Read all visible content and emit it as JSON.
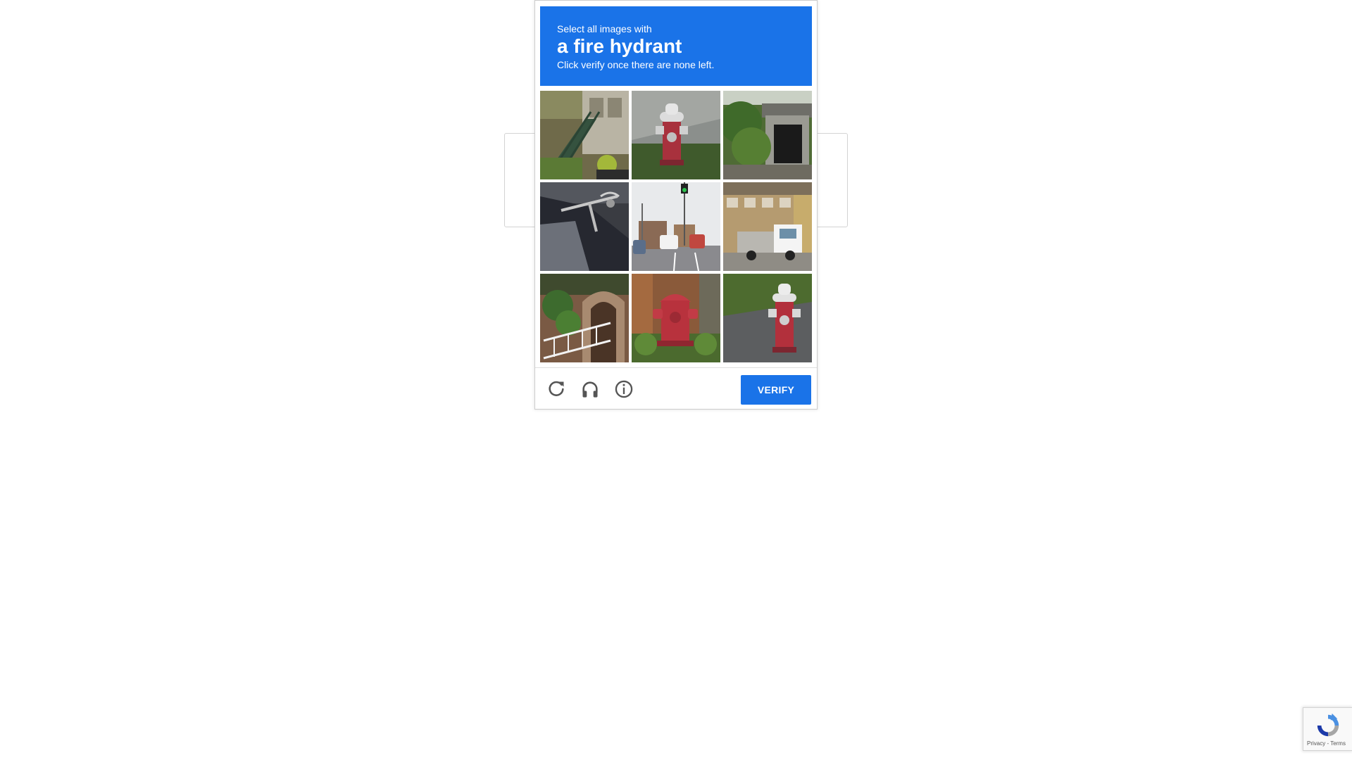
{
  "challenge": {
    "instruction_line1": "Select all images with",
    "target_object": "a fire hydrant",
    "instruction_line3": "Click verify once there are none left.",
    "header_color": "#1a73e8",
    "tiles": [
      {
        "index": 1,
        "scene": "stairs-building"
      },
      {
        "index": 2,
        "scene": "fire-hydrant-white-top"
      },
      {
        "index": 3,
        "scene": "tunnel-trees"
      },
      {
        "index": 4,
        "scene": "bicycle-car"
      },
      {
        "index": 5,
        "scene": "street-traffic"
      },
      {
        "index": 6,
        "scene": "truck-building"
      },
      {
        "index": 7,
        "scene": "house-railing"
      },
      {
        "index": 8,
        "scene": "fire-hydrant-red"
      },
      {
        "index": 9,
        "scene": "fire-hydrant-sidewalk"
      }
    ],
    "footer": {
      "reload_icon": "reload-icon",
      "audio_icon": "headphones-icon",
      "info_icon": "info-icon",
      "verify_label": "VERIFY",
      "verify_color": "#1a73e8"
    }
  },
  "badge": {
    "terms_text": "Privacy - Terms",
    "logo_icon": "recaptcha-logo-icon"
  }
}
